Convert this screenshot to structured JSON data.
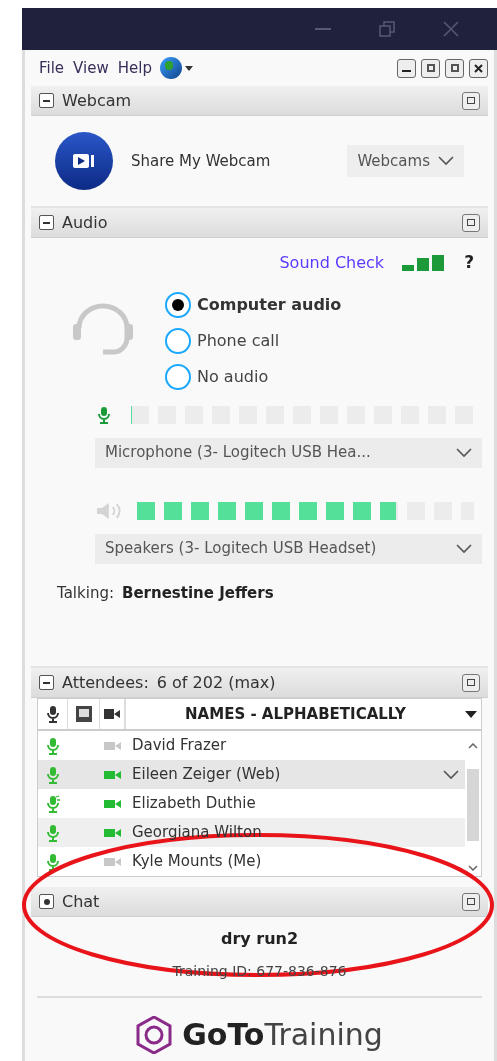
{
  "menu": [
    "File",
    "View",
    "Help"
  ],
  "webcam": {
    "title": "Webcam",
    "share_label": "Share My Webcam",
    "dropdown": "Webcams"
  },
  "audio": {
    "title": "Audio",
    "sound_check": "Sound Check",
    "help": "?",
    "options": [
      {
        "label": "Computer audio",
        "selected": true
      },
      {
        "label": "Phone call",
        "selected": false
      },
      {
        "label": "No audio",
        "selected": false
      }
    ],
    "microphone": {
      "level": 0,
      "device": "Microphone (3- Logitech USB Hea..."
    },
    "speakers": {
      "level": 0.77,
      "device": "Speakers (3- Logitech USB Headset)"
    },
    "talking_label": "Talking:",
    "talking_name": "Bernestine Jeffers"
  },
  "attendees": {
    "title": "Attendees:",
    "count": "6 of 202 (max)",
    "column_header": "NAMES - ALPHABETICALLY",
    "rows": [
      {
        "name": "David Frazer",
        "talking": false,
        "webcam_on": false,
        "selected": false
      },
      {
        "name": "Eileen Zeiger (Web)",
        "talking": false,
        "webcam_on": true,
        "selected": true
      },
      {
        "name": "Elizabeth Duthie",
        "talking": true,
        "webcam_on": true,
        "selected": false
      },
      {
        "name": "Georgiana Wilton",
        "talking": false,
        "webcam_on": true,
        "selected": false
      },
      {
        "name": "Kyle Mounts (Me)",
        "talking": false,
        "webcam_on": false,
        "selected": false
      }
    ]
  },
  "chat": {
    "title": "Chat",
    "expanded": false
  },
  "session": {
    "name": "dry run2",
    "training_id": "Training ID: 677-836-876"
  },
  "logo": {
    "part1": "GoTo",
    "part2": "Training"
  }
}
